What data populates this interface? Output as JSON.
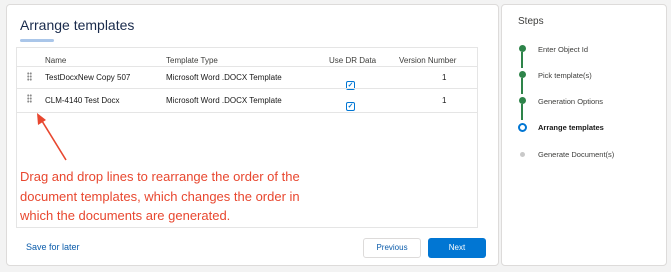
{
  "page": {
    "title": "Arrange templates",
    "accent_color": "#0176d3",
    "success_color": "#2e844a",
    "annotation_color": "#e8472f"
  },
  "table": {
    "columns": [
      "Name",
      "Template Type",
      "Use DR Data",
      "Version Number"
    ],
    "rows": [
      {
        "name": "TestDocxNew Copy 507",
        "type": "Microsoft Word .DOCX Template",
        "use_dr": "✓",
        "version": "1"
      },
      {
        "name": "CLM-4140 Test Docx",
        "type": "Microsoft Word .DOCX Template",
        "use_dr": "✓",
        "version": "1"
      }
    ]
  },
  "annotation": {
    "text": "Drag and drop lines to rearrange the order of the document templates, which changes the order in which the documents are generated."
  },
  "footer": {
    "save_later": "Save for later",
    "previous": "Previous",
    "next": "Next"
  },
  "steps": {
    "title": "Steps",
    "items": [
      {
        "label": "Enter Object Id",
        "status": "complete"
      },
      {
        "label": "Pick template(s)",
        "status": "complete"
      },
      {
        "label": "Generation Options",
        "status": "complete"
      },
      {
        "label": "Arrange templates",
        "status": "current"
      },
      {
        "label": "Generate Document(s)",
        "status": "upcoming"
      }
    ]
  },
  "icons": {
    "drag_handle": "drag-handle-icon",
    "checkbox": "checkbox-checked-icon",
    "step_complete": "check-circle-icon",
    "step_current": "ring-icon",
    "step_upcoming": "dot-icon"
  }
}
